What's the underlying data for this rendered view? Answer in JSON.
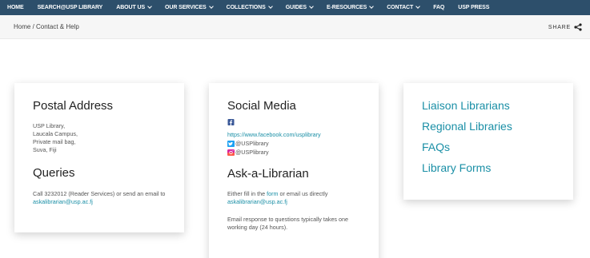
{
  "nav": {
    "items": [
      {
        "label": "HOME",
        "dropdown": false
      },
      {
        "label": "SEARCH@USP LIBRARY",
        "dropdown": false
      },
      {
        "label": "ABOUT US",
        "dropdown": true
      },
      {
        "label": "OUR SERVICES",
        "dropdown": true
      },
      {
        "label": "COLLECTIONS",
        "dropdown": true
      },
      {
        "label": "GUIDES",
        "dropdown": true
      },
      {
        "label": "E-RESOURCES",
        "dropdown": true
      },
      {
        "label": "CONTACT",
        "dropdown": true
      },
      {
        "label": "FAQ",
        "dropdown": false
      },
      {
        "label": "USP PRESS",
        "dropdown": false
      }
    ],
    "bg_color": "#2d4f6b"
  },
  "breadcrumb": {
    "text": "Home / Contact & Help"
  },
  "share": {
    "label": "SHARE"
  },
  "postal": {
    "title": "Postal Address",
    "lines": [
      "USP Library,",
      "Laucala Campus,",
      "Private mail bag,",
      "Suva, Fiji"
    ],
    "queries_title": "Queries",
    "queries_text": "Call 3232012 (Reader Services) or send an email to ",
    "queries_email": "askalibrarian@usp.ac.fj"
  },
  "social": {
    "title": "Social Media",
    "facebook_url": "https://www.facebook.com/usplibrary",
    "twitter_handle": "@USPlibrary",
    "instagram_handle": "@USPlibrary",
    "ask_title": "Ask-a-Librarian",
    "ask_prefix": "Either fill in the ",
    "ask_form_link": "form",
    "ask_middle": " or email us directly ",
    "ask_email": "askalibrarian@usp.ac.fj",
    "response_text": "Email response to questions typically takes one working day (24 hours)."
  },
  "links": {
    "items": [
      "Liaison Librarians",
      "Regional Libraries",
      "FAQs",
      "Library Forms"
    ],
    "color": "#1a8fa6"
  }
}
